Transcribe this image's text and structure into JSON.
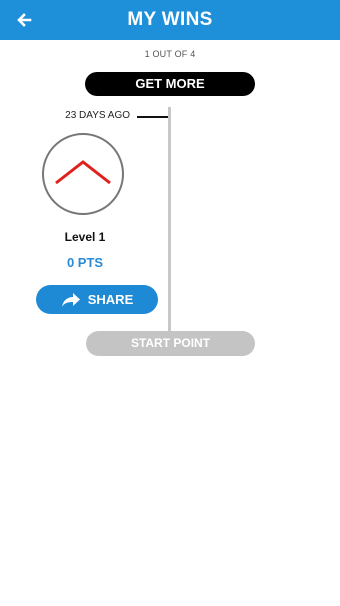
{
  "header": {
    "title": "MY WINS",
    "back_icon": "arrow-left-icon",
    "background_color": "#1e90d9"
  },
  "counter_text": "1 OUT OF 4",
  "get_more_label": "GET MORE",
  "timeline": {
    "entries": [
      {
        "time_ago": "23 DAYS AGO",
        "badge_icon": "chevron-up-icon",
        "level_label": "Level 1",
        "points": "0 PTS",
        "share_label": "SHARE",
        "share_icon": "share-arrow-icon"
      }
    ],
    "start_label": "START POINT"
  },
  "colors": {
    "accent": "#1e8ad6",
    "points": "#2a8ad6",
    "badge_chevron": "#e0201b",
    "start_point": "#c4c4c4",
    "timeline_line": "#c8c8c8"
  }
}
